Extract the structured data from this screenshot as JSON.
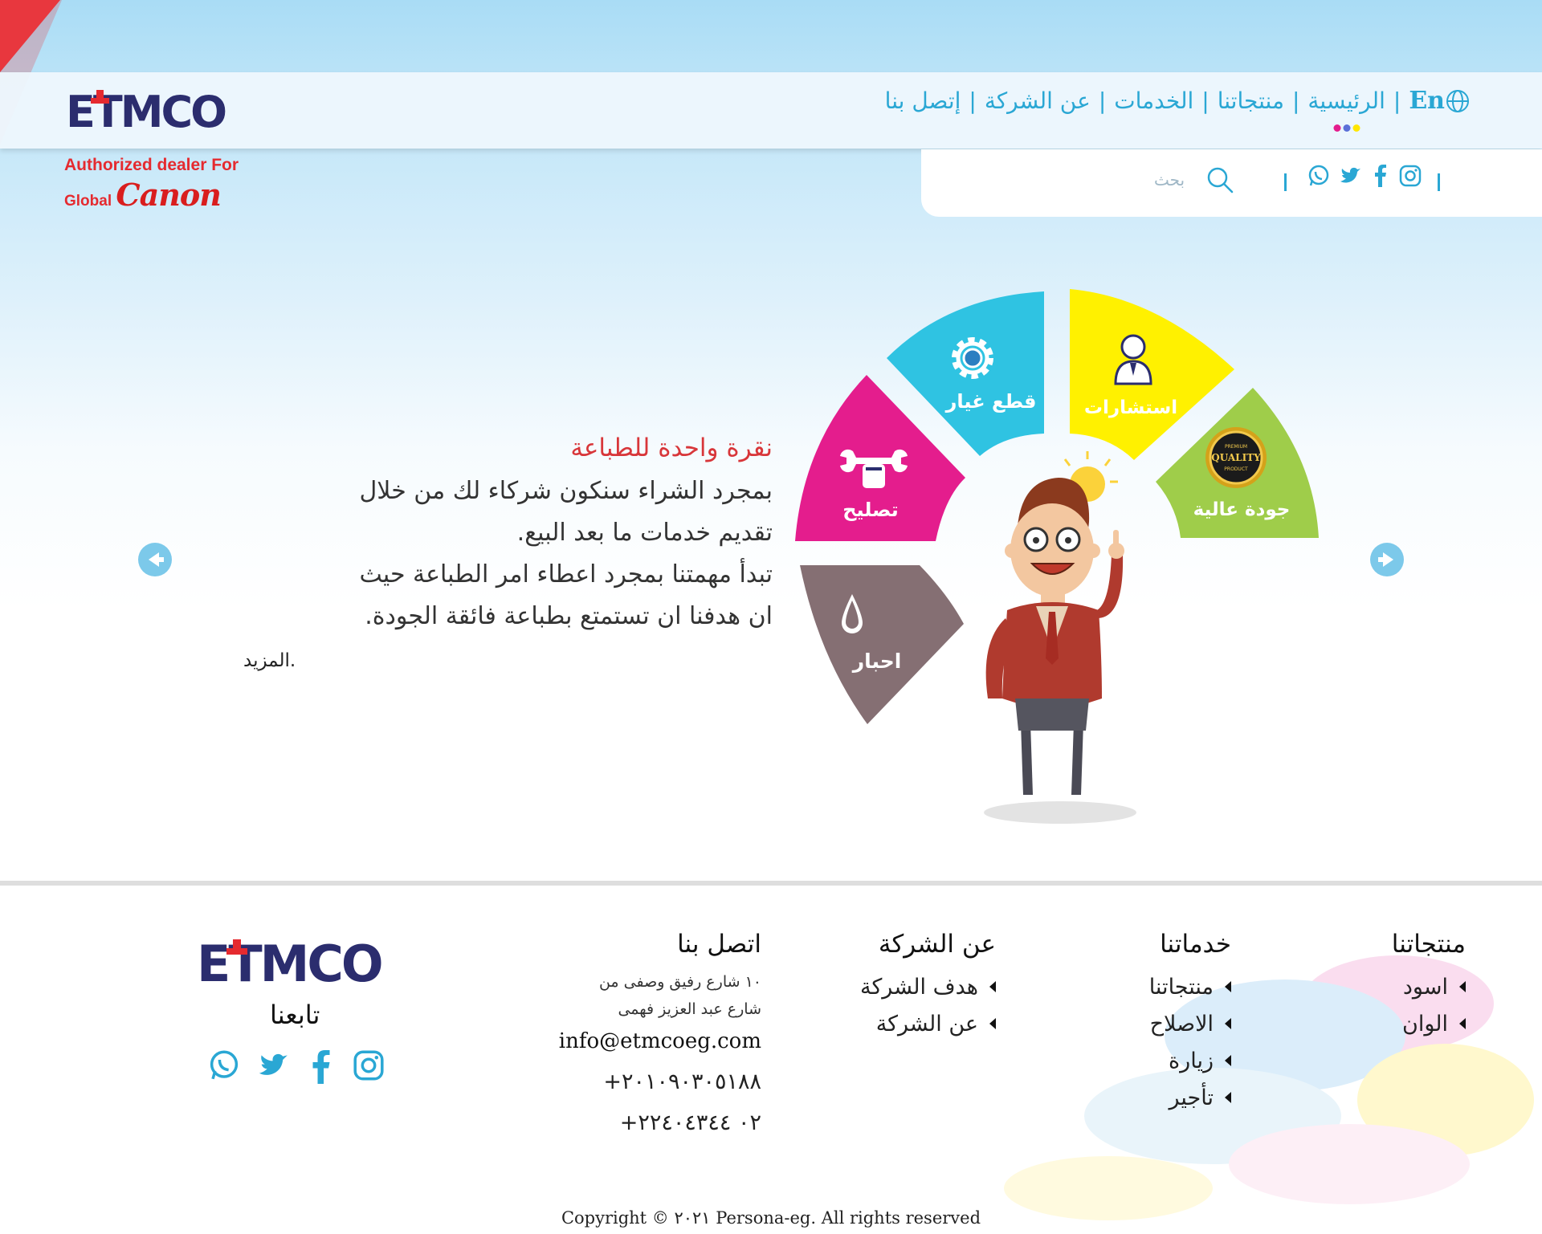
{
  "brand": {
    "logo_text": "ETMCO",
    "dealer_line1": "Authorized dealer For",
    "dealer_global": "Global",
    "dealer_canon": "Canon"
  },
  "nav": {
    "lang": "En",
    "items": [
      "الرئيسية",
      "منتجاتنا",
      "الخدمات",
      "عن الشركة",
      "إتصل بنا"
    ],
    "separator": "|"
  },
  "search": {
    "placeholder": "بحث"
  },
  "hero": {
    "title": "نقرة واحدة للطباعة",
    "line1": "بمجرد الشراء سنكون شركاء لك من خلال",
    "line2": "تقديم خدمات ما بعد البيع.",
    "line3": "تبدأ مهمتنا بمجرد اعطاء امر الطباعة حيث",
    "line4": "ان هدفنا ان تستمتع بطباعة فائقة الجودة.",
    "more": "المزيد."
  },
  "wheel": {
    "segments": [
      {
        "label": "احبار",
        "color": "#856f73",
        "icon": "ink-drop-icon"
      },
      {
        "label": "تصليح",
        "color": "#e41d8d",
        "icon": "wrench-icon"
      },
      {
        "label": "قطع غيار",
        "color": "#2fc3e2",
        "icon": "gear-icon"
      },
      {
        "label": "استشارات",
        "color": "#fff100",
        "icon": "consultant-icon"
      },
      {
        "label": "جودة عالية",
        "color": "#9fcd4a",
        "icon": "quality-badge-icon"
      }
    ],
    "badge_top": "PREMIUM",
    "badge_mid": "QUALITY",
    "badge_bottom": "PRODUCT"
  },
  "footer": {
    "products": {
      "title": "منتجاتنا",
      "items": [
        "اسود",
        "الوان"
      ]
    },
    "services": {
      "title": "خدماتنا",
      "items": [
        "منتجاتنا",
        "الاصلاح",
        "زيارة",
        "تأجير"
      ]
    },
    "about": {
      "title": "عن الشركة",
      "items": [
        "هدف الشركة",
        "عن الشركة"
      ]
    },
    "contact": {
      "title": "اتصل بنا",
      "address1": "١٠ شارع رفيق وصفى من",
      "address2": "شارع عبد العزيز فهمى",
      "email": "info@etmcoeg.com",
      "phone1": "+٢٠١٠٩٠٣٠٥١٨٨",
      "phone2": "+٠٢ ٢٢٤٠٤٣٤٤"
    },
    "logo_text": "ETMCO",
    "follow": "تابعنا",
    "copyright": "Copyright © ٢٠٢١ Persona-eg. All rights reserved"
  },
  "colors": {
    "accent": "#2aa7d4",
    "brand_navy": "#2b2d6e",
    "brand_red": "#e52a2f"
  }
}
